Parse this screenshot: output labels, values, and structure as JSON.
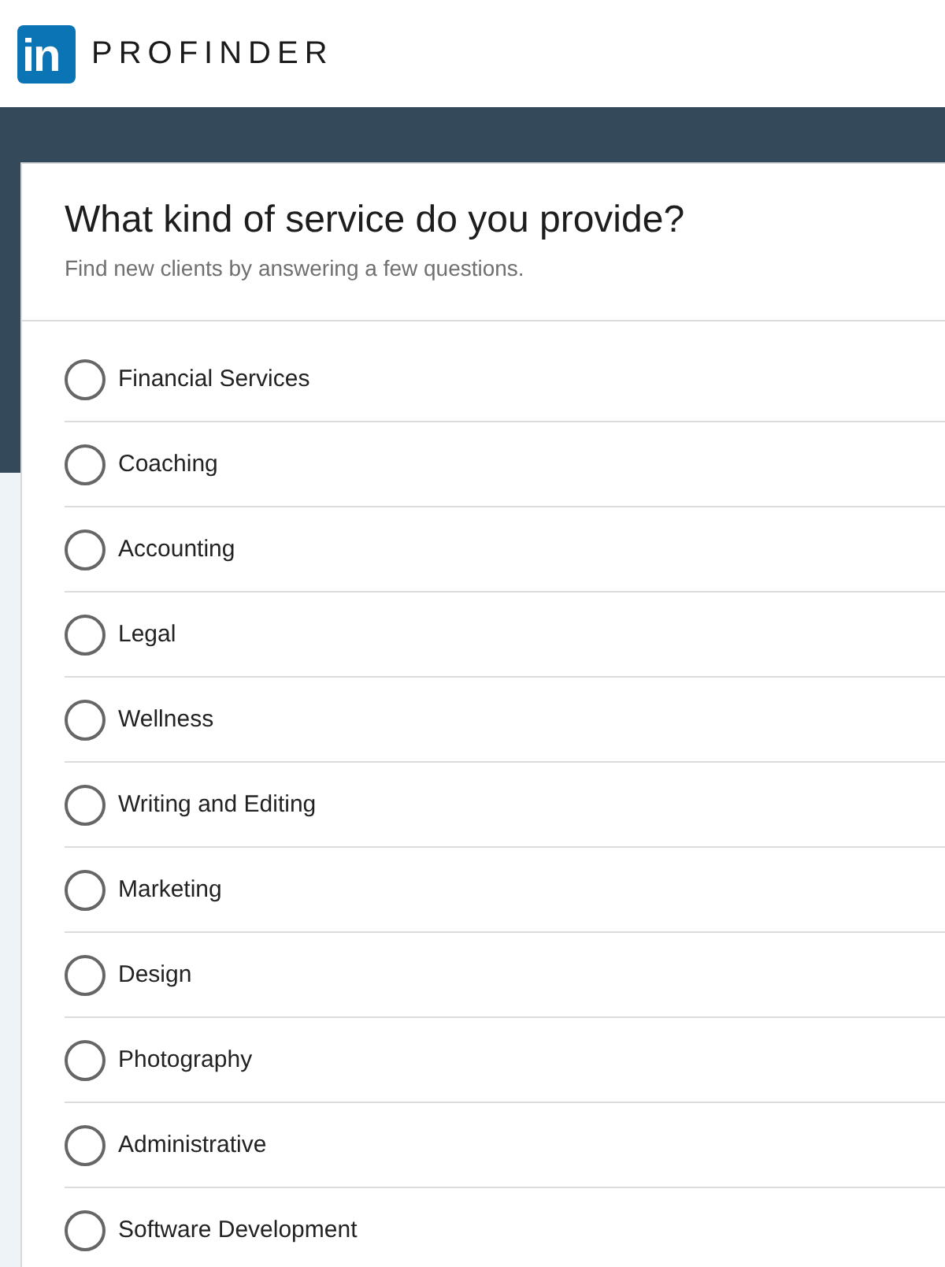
{
  "header": {
    "logo": "in",
    "brand": "PROFINDER"
  },
  "card": {
    "title": "What kind of service do you provide?",
    "subtitle": "Find new clients by answering a few questions.",
    "options": [
      {
        "label": "Financial Services",
        "selected": false
      },
      {
        "label": "Coaching",
        "selected": false
      },
      {
        "label": "Accounting",
        "selected": false
      },
      {
        "label": "Legal",
        "selected": false
      },
      {
        "label": "Wellness",
        "selected": false
      },
      {
        "label": "Writing and Editing",
        "selected": false
      },
      {
        "label": "Marketing",
        "selected": false
      },
      {
        "label": "Design",
        "selected": false
      },
      {
        "label": "Photography",
        "selected": false
      },
      {
        "label": "Administrative",
        "selected": false
      },
      {
        "label": "Software Development",
        "selected": false
      }
    ]
  }
}
